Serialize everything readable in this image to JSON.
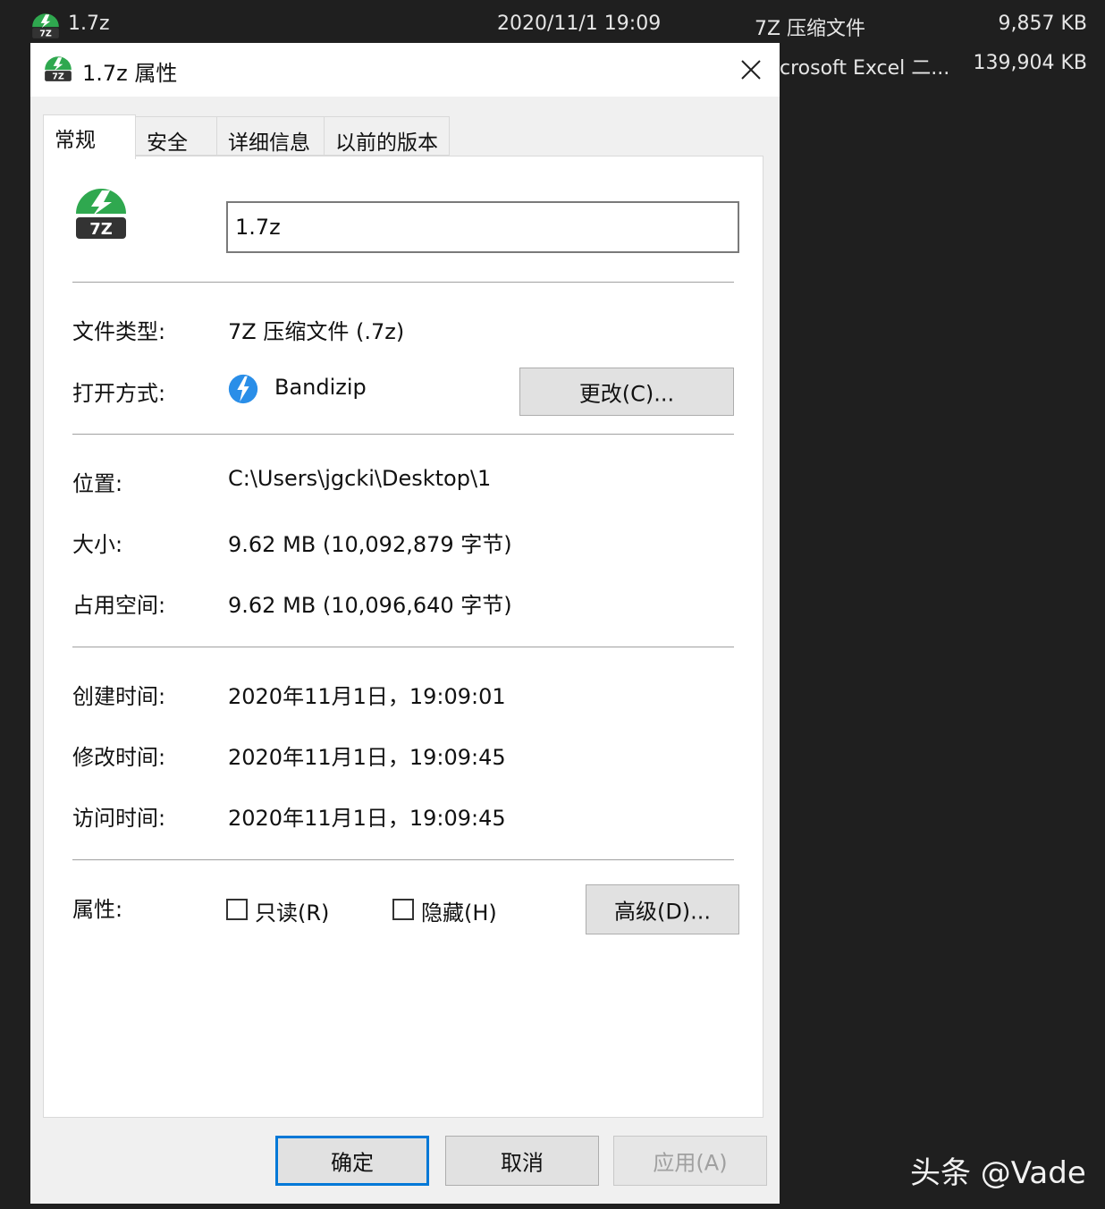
{
  "explorer": {
    "rows": [
      {
        "name": "1.7z",
        "date": "2020/11/1 19:09",
        "type": "7Z 压缩文件",
        "size": "9,857 KB"
      },
      {
        "name": "",
        "date": "",
        "type": "crosoft Excel 二...",
        "size": "139,904 KB"
      }
    ]
  },
  "dialog": {
    "title": "1.7z 属性",
    "close_icon": "close-icon",
    "tabs": [
      {
        "label": "常规"
      },
      {
        "label": "安全"
      },
      {
        "label": "详细信息"
      },
      {
        "label": "以前的版本"
      }
    ],
    "filename": "1.7z",
    "file_icon_label": "7Z",
    "properties": {
      "type_label": "文件类型:",
      "type_value": "7Z 压缩文件 (.7z)",
      "open_label": "打开方式:",
      "open_value": "Bandizip",
      "change_button": "更改(C)...",
      "location_label": "位置:",
      "location_value": "C:\\Users\\jgcki\\Desktop\\1",
      "size_label": "大小:",
      "size_value": "9.62 MB (10,092,879 字节)",
      "disk_label": "占用空间:",
      "disk_value": "9.62 MB (10,096,640 字节)",
      "created_label": "创建时间:",
      "created_value": "2020年11月1日，19:09:01",
      "modified_label": "修改时间:",
      "modified_value": "2020年11月1日，19:09:45",
      "accessed_label": "访问时间:",
      "accessed_value": "2020年11月1日，19:09:45",
      "attributes_label": "属性:",
      "readonly_label": "只读(R)",
      "hidden_label": "隐藏(H)",
      "advanced_button": "高级(D)..."
    },
    "buttons": {
      "ok": "确定",
      "cancel": "取消",
      "apply": "应用(A)"
    }
  },
  "watermark": "头条 @Vade",
  "colors": {
    "icon_green": "#2fa84f",
    "icon_dark": "#333333",
    "bandizip_blue": "#2a8ee8",
    "focus_blue": "#0078d7"
  }
}
